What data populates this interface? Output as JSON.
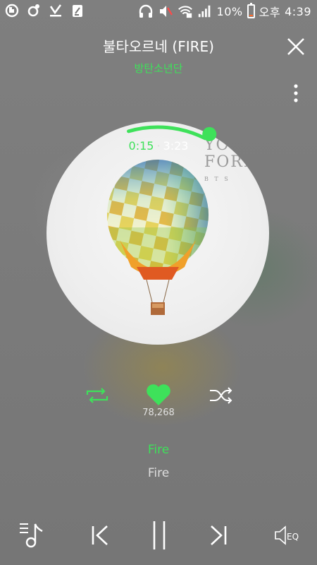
{
  "status_bar": {
    "battery_text": "10%",
    "ampm": "오후",
    "time": "4:39",
    "battery_level": 0.1
  },
  "header": {
    "title": "불타오르네 (FIRE)",
    "artist": "방탄소년단"
  },
  "player": {
    "current_time": "0:15",
    "separator": "·",
    "total_time": "3:23",
    "progress": 0.074,
    "likes": "78,268",
    "lyric_current": "Fire",
    "lyric_next": "Fire",
    "cover_text_line1": "YO",
    "cover_text_line2": "FOREV",
    "cover_text_small": "B T S"
  },
  "icons": {
    "repeat": "repeat-icon",
    "like": "heart-icon",
    "shuffle": "shuffle-icon",
    "playlist": "playlist-icon",
    "prev": "previous-icon",
    "pause": "pause-icon",
    "next": "next-icon",
    "eq": "equalizer-icon",
    "close": "close-icon",
    "more": "more-vertical-icon"
  },
  "colors": {
    "accent": "#3ee15a",
    "text": "#ffffff",
    "muted": "#dddddd",
    "background": "#7d7d7d"
  }
}
